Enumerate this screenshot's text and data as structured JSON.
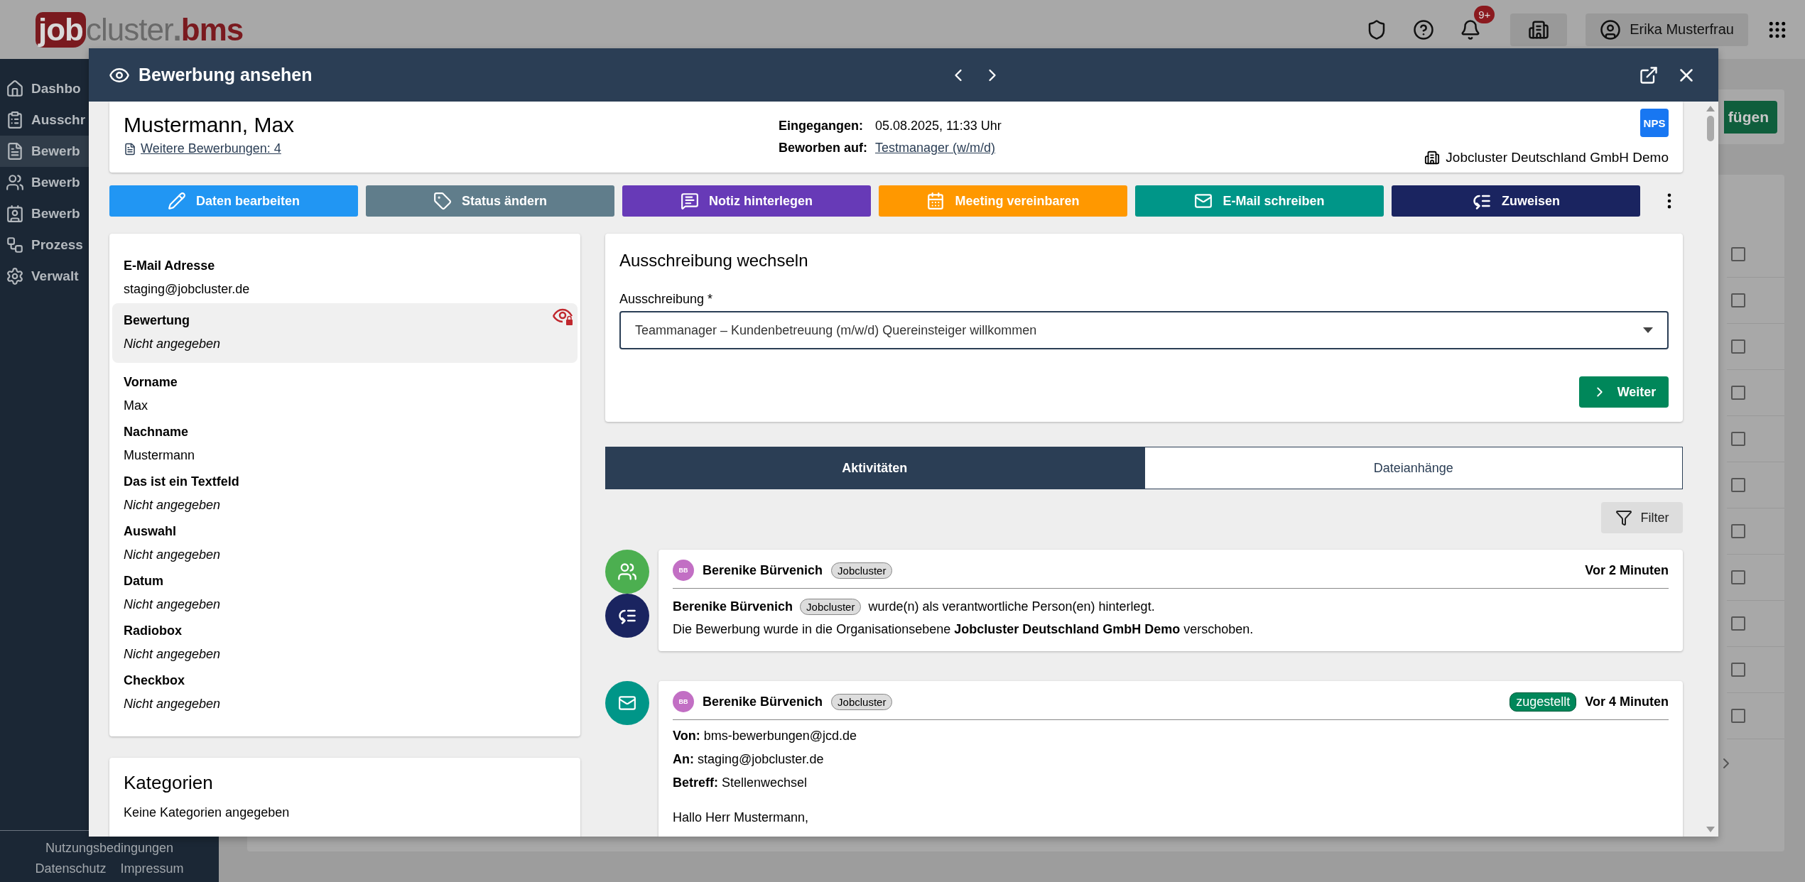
{
  "header": {
    "logo": {
      "badge": "job",
      "name": "cluster",
      "dot": ".",
      "product": "bms"
    },
    "notification_count": "9+",
    "user": "Erika Musterfrau"
  },
  "sidebar": {
    "items": [
      {
        "label": "Dashbo",
        "kind": "home",
        "selected": false
      },
      {
        "label": "Ausschr",
        "kind": "clipboard",
        "selected": false
      },
      {
        "label": "Bewerb",
        "kind": "document",
        "selected": true
      },
      {
        "label": "Bewerb",
        "kind": "people",
        "selected": false
      },
      {
        "label": "Bewerb",
        "kind": "card",
        "selected": false
      },
      {
        "label": "Prozess",
        "kind": "process",
        "selected": false
      },
      {
        "label": "Verwalt",
        "kind": "settings",
        "selected": false
      }
    ],
    "footer_links": [
      "Nutzungsbedingungen",
      "Datenschutz",
      "Impressum"
    ]
  },
  "background": {
    "add_button": "fügen",
    "rows": [
      {
        "checked": false
      },
      {
        "checked": false
      },
      {
        "checked": false
      },
      {
        "checked": false
      },
      {
        "checked": false
      },
      {
        "checked": false
      },
      {
        "checked": false
      },
      {
        "checked": false
      },
      {
        "checked": false
      },
      {
        "checked": false
      },
      {
        "checked": false
      }
    ]
  },
  "modal": {
    "title": "Bewerbung ansehen",
    "applicant": {
      "name": "Mustermann, Max",
      "more_link": "Weitere Bewerbungen: 4",
      "meta": [
        {
          "label": "Eingegangen:",
          "value": "05.08.2025, 11:33 Uhr",
          "link": false
        },
        {
          "label": "Beworben auf:",
          "value": "Testmanager (w/m/d)",
          "link": true
        }
      ],
      "badge": "NPS",
      "organization": "Jobcluster Deutschland GmbH Demo"
    },
    "actions": [
      {
        "label": "Daten bearbeiten",
        "kind": "edit",
        "color": "#2196f3"
      },
      {
        "label": "Status ändern",
        "kind": "status",
        "color": "#607d8b"
      },
      {
        "label": "Notiz hinterlegen",
        "kind": "note",
        "color": "#673ab7"
      },
      {
        "label": "Meeting vereinbaren",
        "kind": "meeting",
        "color": "#ff9800"
      },
      {
        "label": "E-Mail schreiben",
        "kind": "email",
        "color": "#009688"
      },
      {
        "label": "Zuweisen",
        "kind": "assign",
        "color": "#1a2460"
      }
    ],
    "fields": [
      {
        "label": "E-Mail Adresse",
        "value": "staging@jobcluster.de",
        "empty": false,
        "restricted": false
      },
      {
        "label": "Bewertung",
        "value": "Nicht angegeben",
        "empty": true,
        "restricted": true
      },
      {
        "label": "Vorname",
        "value": "Max",
        "empty": false,
        "restricted": false
      },
      {
        "label": "Nachname",
        "value": "Mustermann",
        "empty": false,
        "restricted": false
      },
      {
        "label": "Das ist ein Textfeld",
        "value": "Nicht angegeben",
        "empty": true,
        "restricted": false
      },
      {
        "label": "Auswahl",
        "value": "Nicht angegeben",
        "empty": true,
        "restricted": false
      },
      {
        "label": "Datum",
        "value": "Nicht angegeben",
        "empty": true,
        "restricted": false
      },
      {
        "label": "Radiobox",
        "value": "Nicht angegeben",
        "empty": true,
        "restricted": false
      },
      {
        "label": "Checkbox",
        "value": "Nicht angegeben",
        "empty": true,
        "restricted": false
      }
    ],
    "categories": {
      "title": "Kategorien",
      "text": "Keine Kategorien angegeben"
    },
    "switch": {
      "title": "Ausschreibung wechseln",
      "field_label": "Ausschreibung *",
      "value": "Teammanager – Kundenbetreuung (m/w/d) Quereinsteiger willkommen",
      "button": "Weiter"
    },
    "tabs": [
      {
        "label": "Aktivitäten",
        "selected": true
      },
      {
        "label": "Dateianhänge",
        "selected": false
      }
    ],
    "filter": "Filter",
    "activities": [
      {
        "kind": "assignment",
        "markers": [
          {
            "kind": "contact"
          },
          {
            "kind": "assign"
          }
        ],
        "avatar": "BB",
        "author": "Berenike Bürvenich",
        "tag": "Jobcluster",
        "time": "Vor 2 Minuten",
        "person": "Berenike Bürvenich",
        "person_tag": "Jobcluster",
        "text": "wurde(n) als verantwortliche Person(en) hinterlegt.",
        "note": "Die Bewerbung wurde in die Organisationsebene **Jobcluster Deutschland GmbH Demo** verschoben."
      },
      {
        "kind": "email",
        "markers": [
          {
            "kind": "mail"
          }
        ],
        "avatar": "BB",
        "author": "Berenike Bürvenich",
        "tag": "Jobcluster",
        "status": "zugestellt",
        "time": "Vor 4 Minuten",
        "mail": [
          {
            "label": "Von:",
            "value": "bms-bewerbungen@jcd.de"
          },
          {
            "label": "An:",
            "value": "staging@jobcluster.de"
          },
          {
            "label": "Betreff:",
            "value": "Stellenwechsel"
          }
        ],
        "greeting": "Hallo Herr Mustermann,"
      }
    ]
  }
}
